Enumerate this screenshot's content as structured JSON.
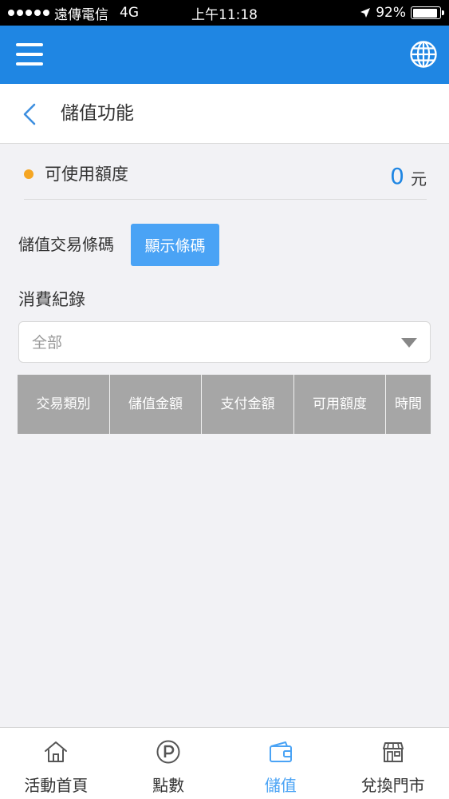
{
  "status_bar": {
    "carrier": "遠傳電信",
    "network": "4G",
    "time": "上午11:18",
    "battery_percent": "92%",
    "battery_level": 0.92,
    "signal_icon": "signal-dots-icon",
    "location_icon": "location-arrow-icon"
  },
  "header": {
    "menu_icon": "menu-icon",
    "language_icon": "globe-icon",
    "color": "#1f86e3"
  },
  "subheader": {
    "back_icon": "back-chevron-icon",
    "title": "儲值功能"
  },
  "balance": {
    "label": "可使用額度",
    "amount": "0",
    "unit": "元",
    "dot_color": "#f5a623"
  },
  "barcode": {
    "label": "儲值交易條碼",
    "button_label": "顯示條碼"
  },
  "records": {
    "label": "消費紀錄",
    "filter_value": "全部",
    "columns": [
      "交易類別",
      "儲值金額",
      "支付金額",
      "可用額度",
      "時間"
    ],
    "rows": []
  },
  "tabbar": {
    "tabs": [
      {
        "label": "活動首頁",
        "icon": "home-icon",
        "active": false
      },
      {
        "label": "點數",
        "icon": "points-icon",
        "active": false
      },
      {
        "label": "儲值",
        "icon": "wallet-icon",
        "active": true
      },
      {
        "label": "兌換門市",
        "icon": "store-icon",
        "active": false
      }
    ],
    "active_color": "#4aa3f5"
  }
}
